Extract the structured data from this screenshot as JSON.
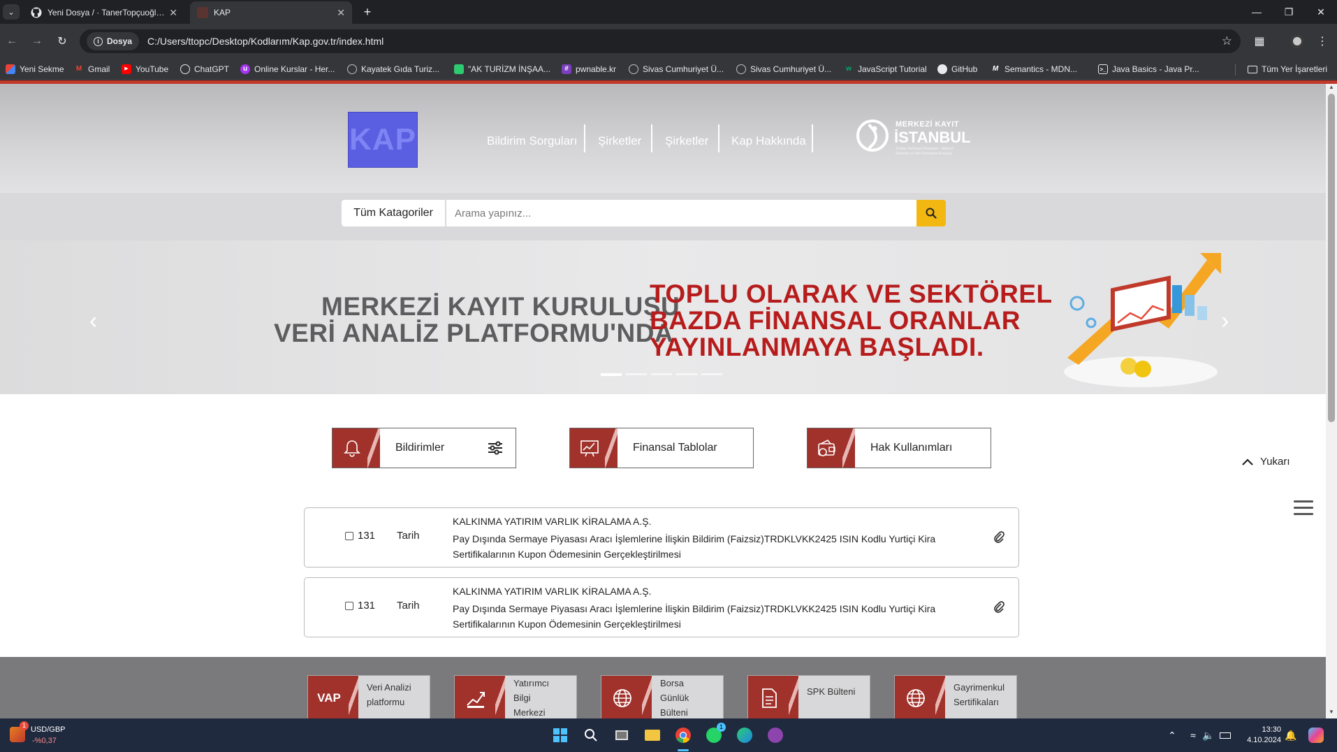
{
  "browser": {
    "tabs": [
      {
        "title": "Yeni Dosya / · TanerTopçuoğlu/K",
        "active": false
      },
      {
        "title": "KAP",
        "active": true
      }
    ],
    "new_tab": "+",
    "omnibox": {
      "chip": "Dosya",
      "url": "C:/Users/ttopc/Desktop/Kodlarım/Kap.gov.tr/index.html"
    },
    "bookmarks": [
      {
        "label": "Yeni Sekme",
        "icon": "grid-icon",
        "color": "#4285f4"
      },
      {
        "label": "Gmail",
        "icon": "gmail-icon",
        "color": "#ea4335"
      },
      {
        "label": "YouTube",
        "icon": "youtube-icon",
        "color": "#ff0000"
      },
      {
        "label": "ChatGPT",
        "icon": "chatgpt-icon",
        "color": "#ffffff"
      },
      {
        "label": "Online Kurslar - Her...",
        "icon": "udemy-icon",
        "color": "#a435f0"
      },
      {
        "label": "Kayatek Gıda Turiz...",
        "icon": "globe-icon",
        "color": "#bdc1c6"
      },
      {
        "label": "\"AK TURİZM İNŞAA...",
        "icon": "site-icon",
        "color": "#2ecc71"
      },
      {
        "label": "pwnable.kr",
        "icon": "hash-icon",
        "color": "#7b3fbf"
      },
      {
        "label": "Sivas Cumhuriyet Ü...",
        "icon": "globe-icon",
        "color": "#bdc1c6"
      },
      {
        "label": "Sivas Cumhuriyet Ü...",
        "icon": "globe-icon",
        "color": "#bdc1c6"
      },
      {
        "label": "JavaScript Tutorial",
        "icon": "w3-icon",
        "color": "#04aa6d"
      },
      {
        "label": "GitHub",
        "icon": "github-icon",
        "color": "#ffffff"
      },
      {
        "label": "Semantics - MDN...",
        "icon": "mdn-icon",
        "color": "#ffffff"
      },
      {
        "label": "Java Basics - Java Pr...",
        "icon": "terminal-icon",
        "color": "#ffffff"
      }
    ],
    "all_bookmarks": "Tüm Yer İşaretleri"
  },
  "site": {
    "logo_text": "KAP",
    "nav": [
      "Bildirim Sorguları",
      "Şirketler",
      "Şirketler",
      "Kap Hakkında"
    ],
    "partner_logo": {
      "line1": "MERKEZİ KAYIT",
      "line2": "İSTANBUL",
      "tagline": "Türkiye Sermaye Piyasaları · Merkezi Saklama ve Veri Depolama Kuruluşu"
    },
    "search": {
      "category": "Tüm Katagoriler",
      "placeholder": "Arama yapınız..."
    },
    "carousel": {
      "left_line1": "MERKEZİ KAYIT KURULUŞU",
      "left_line2": "VERİ ANALİZ PLATFORMU'NDA",
      "right_line1": "TOPLU OLARAK VE SEKTÖREL",
      "right_line2": "BAZDA FİNANSAL ORANLAR",
      "right_line3": "YAYINLANMAYA BAŞLADI.",
      "slide_count": 5,
      "active_slide": 1
    },
    "features": [
      {
        "label": "Bildirimler",
        "icon": "bell-icon"
      },
      {
        "label": "Finansal Tablolar",
        "icon": "chart-icon"
      },
      {
        "label": "Hak Kullanımları",
        "icon": "wallet-icon"
      }
    ],
    "back_to_top": "Yukarı",
    "notifications": [
      {
        "number": "131",
        "date": "Tarih",
        "company": "KALKINMA YATIRIM VARLIK KİRALAMA A.Ş.",
        "subject": "Pay Dışında Sermaye Piyasası Aracı İşlemlerine İlişkin Bildirim (Faizsiz)TRDKLVKK2425 ISIN Kodlu Yurtiçi Kira Sertifikalarının Kupon Ödemesinin Gerçekleştirilmesi"
      },
      {
        "number": "131",
        "date": "Tarih",
        "company": "KALKINMA YATIRIM VARLIK KİRALAMA A.Ş.",
        "subject": "Pay Dışında Sermaye Piyasası Aracı İşlemlerine İlişkin Bildirim (Faizsiz)TRDKLVKK2425 ISIN Kodlu Yurtiçi Kira Sertifikalarının Kupon Ödemesinin Gerçekleştirilmesi"
      }
    ],
    "footer_cards": [
      {
        "line1": "Veri Analizi",
        "line2": "platformu",
        "line3": "",
        "icon": "vap-icon",
        "icon_text": "VAP"
      },
      {
        "line1": "Yatırımcı",
        "line2": "Bilgi",
        "line3": "Merkezi",
        "icon": "investor-icon",
        "icon_text": ""
      },
      {
        "line1": "Borsa",
        "line2": "Günlük",
        "line3": "Bülteni",
        "icon": "globe-icon",
        "icon_text": ""
      },
      {
        "line1": "SPK Bülteni",
        "line2": "",
        "line3": "",
        "icon": "document-icon",
        "icon_text": ""
      },
      {
        "line1": "Gayrimenkul",
        "line2": "Sertifikaları",
        "line3": "",
        "icon": "globe-icon",
        "icon_text": ""
      }
    ]
  },
  "taskbar": {
    "ticker": {
      "symbol": "USD/GBP",
      "change": "-%0,37",
      "badge": "1"
    },
    "time": "13:30",
    "date": "4.10.2024",
    "whatsapp_badge": "1"
  },
  "colors": {
    "accent_red": "#a0312b",
    "search_yellow": "#f3b712",
    "kap_blue": "#5a5ee0"
  }
}
